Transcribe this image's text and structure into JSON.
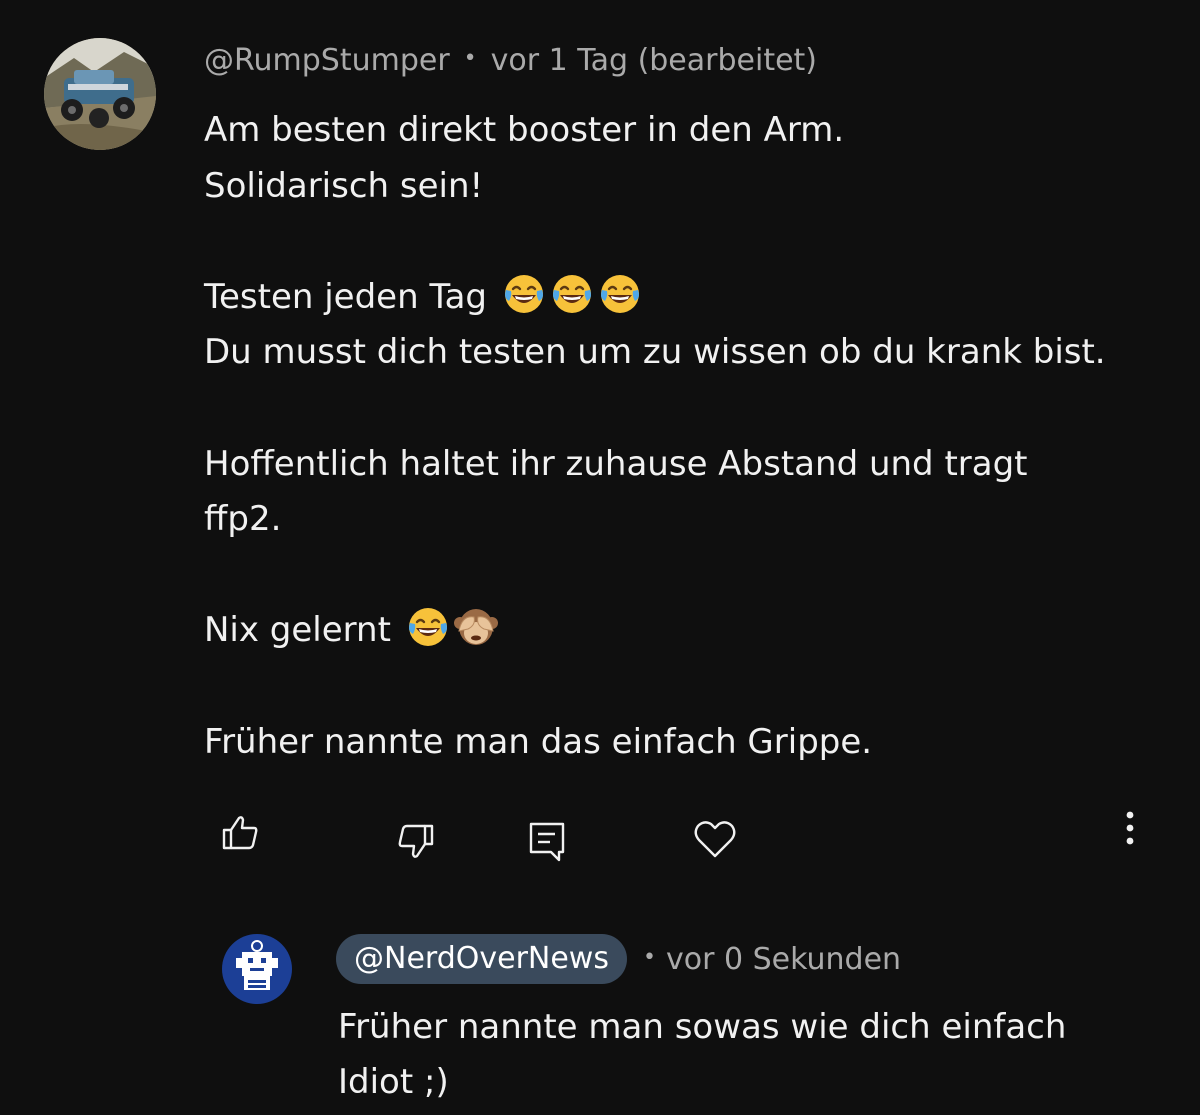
{
  "comment": {
    "author": "@RumpStumper",
    "separator": "•",
    "time": "vor 1 Tag (bearbeitet)",
    "lines": [
      "Am besten direkt booster in den Arm.",
      "Solidarisch sein!",
      "",
      "Testen jeden Tag",
      "Du musst dich testen um zu wissen ob du krank bist.",
      "",
      "Hoffentlich haltet ihr zuhause Abstand und tragt",
      "ffp2.",
      "",
      "Nix gelernt",
      "",
      "Früher nannte man das einfach Grippe."
    ],
    "emoji": {
      "line_3": [
        "face-with-tears-of-joy",
        "face-with-tears-of-joy",
        "face-with-tears-of-joy"
      ],
      "line_9": [
        "face-with-tears-of-joy",
        "see-no-evil-monkey"
      ]
    },
    "actions": [
      "like-icon",
      "dislike-icon",
      "reply-icon",
      "heart-icon",
      "more-icon"
    ]
  },
  "reply": {
    "author": "@NerdOverNews",
    "separator": "•",
    "time": "vor 0 Sekunden",
    "lines": [
      "Früher nannte man sowas wie dich einfach",
      "Idiot ;)"
    ]
  },
  "colors": {
    "background": "#0f0f0f",
    "text": "#f1f1f1",
    "secondary_text": "#aaaaaa",
    "handle_pill": "#3a4a5c"
  }
}
